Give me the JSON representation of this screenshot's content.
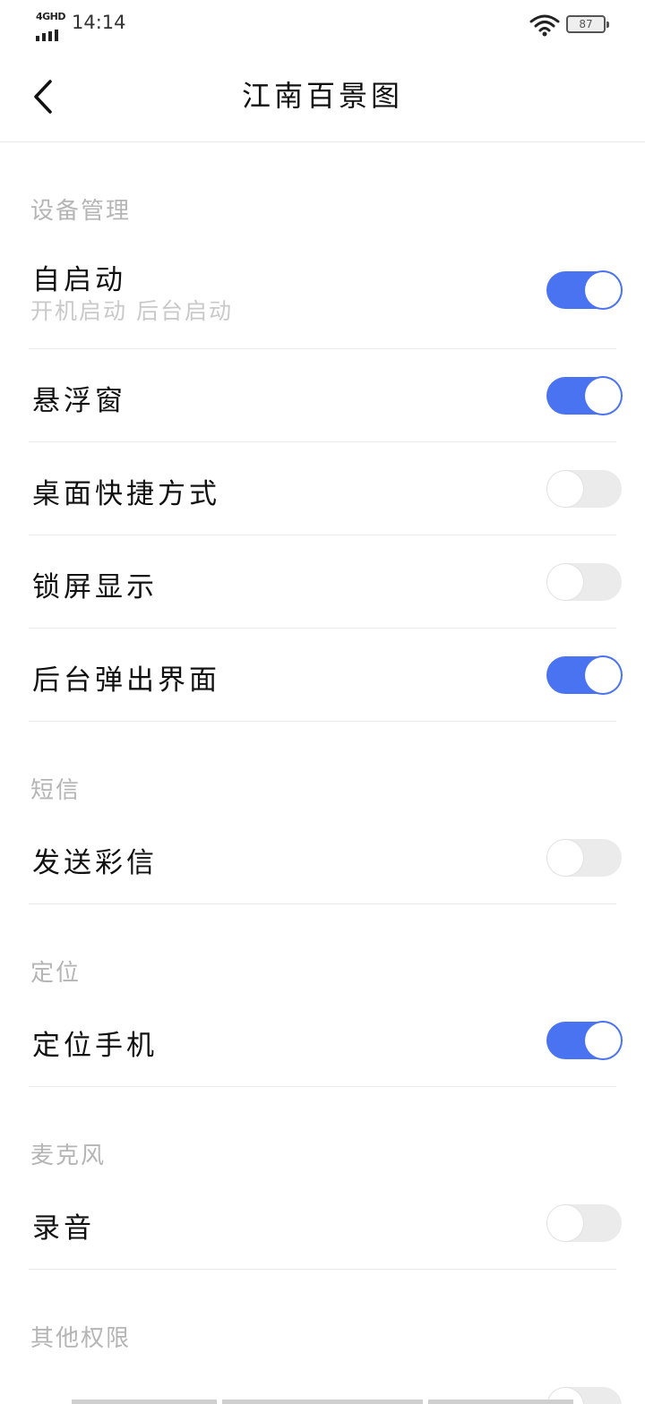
{
  "status_bar": {
    "network": "4GHD",
    "time": "14:14",
    "battery": "87"
  },
  "app_bar": {
    "title": "江南百景图"
  },
  "sections": [
    {
      "header": "设备管理",
      "items": [
        {
          "label": "自启动",
          "sub": "开机启动  后台启动",
          "on": true
        },
        {
          "label": "悬浮窗",
          "on": true
        },
        {
          "label": "桌面快捷方式",
          "on": false
        },
        {
          "label": "锁屏显示",
          "on": false
        },
        {
          "label": "后台弹出界面",
          "on": true
        }
      ]
    },
    {
      "header": "短信",
      "items": [
        {
          "label": "发送彩信",
          "on": false
        }
      ]
    },
    {
      "header": "定位",
      "items": [
        {
          "label": "定位手机",
          "on": true
        }
      ]
    },
    {
      "header": "麦克风",
      "items": [
        {
          "label": "录音",
          "on": false
        }
      ]
    },
    {
      "header": "其他权限",
      "items": []
    }
  ],
  "colors": {
    "accent": "#4a73f2",
    "toggle_off": "#ebebeb",
    "section_header": "#b5b5b5"
  }
}
